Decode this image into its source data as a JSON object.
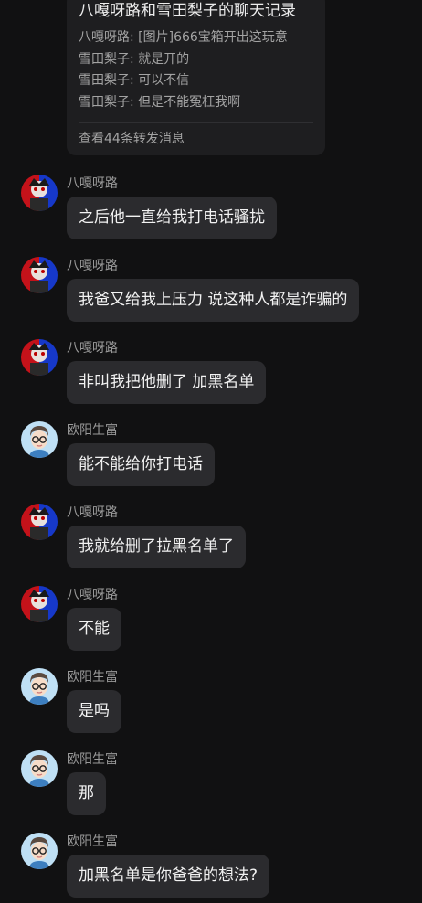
{
  "forward_card": {
    "title": "八嘎呀路和雪田梨子的聊天记录",
    "lines": [
      "八嘎呀路: [图片]666宝箱开出这玩意",
      "雪田梨子: 就是开的",
      "雪田梨子: 可以不信",
      "雪田梨子: 但是不能冤枉我啊"
    ],
    "footer": "查看44条转发消息"
  },
  "messages": [
    {
      "sender": "八嘎呀路",
      "text": "之后他一直给我打电话骚扰",
      "avatar": "red-blue-anime-avatar"
    },
    {
      "sender": "八嘎呀路",
      "text": "我爸又给我上压力 说这种人都是诈骗的",
      "avatar": "red-blue-anime-avatar"
    },
    {
      "sender": "八嘎呀路",
      "text": "非叫我把他删了 加黑名单",
      "avatar": "red-blue-anime-avatar"
    },
    {
      "sender": "欧阳生富",
      "text": "能不能给你打电话",
      "avatar": "glasses-boy-avatar"
    },
    {
      "sender": "八嘎呀路",
      "text": "我就给删了拉黑名单了",
      "avatar": "red-blue-anime-avatar"
    },
    {
      "sender": "八嘎呀路",
      "text": "不能",
      "avatar": "red-blue-anime-avatar"
    },
    {
      "sender": "欧阳生富",
      "text": "是吗",
      "avatar": "glasses-boy-avatar"
    },
    {
      "sender": "欧阳生富",
      "text": "那",
      "avatar": "glasses-boy-avatar"
    },
    {
      "sender": "欧阳生富",
      "text": "加黑名单是你爸爸的想法?",
      "avatar": "glasses-boy-avatar"
    }
  ],
  "colors": {
    "background": "#111112",
    "bubble": "#2b2b2e",
    "card": "#1e1e20",
    "text_primary": "#f2f2f2",
    "text_secondary": "#9a9a9a"
  }
}
